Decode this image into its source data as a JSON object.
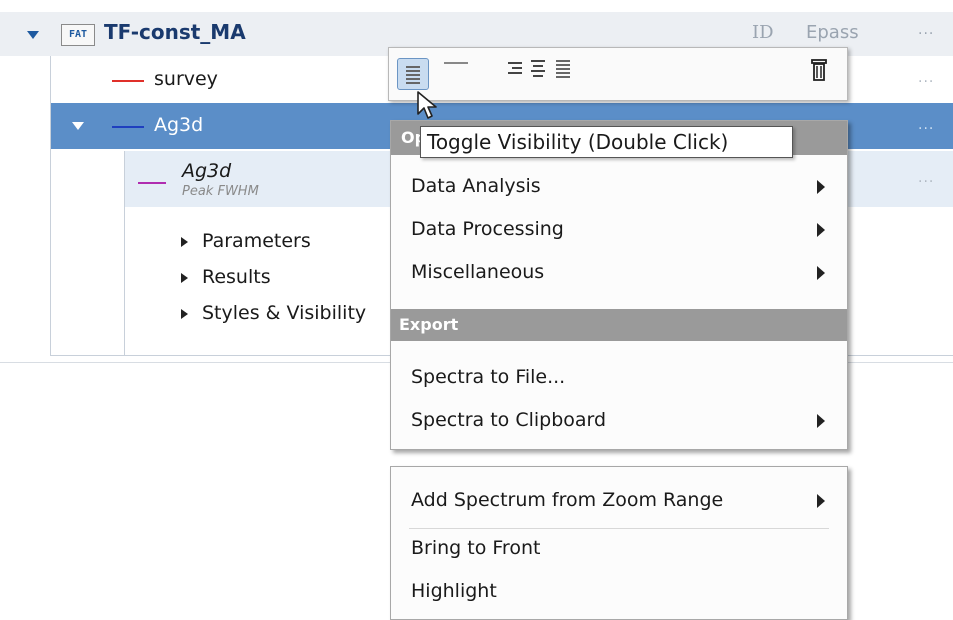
{
  "tree": {
    "root": {
      "badge": "FAT",
      "title": "TF-const_MA",
      "col_id": "ID",
      "col_epass": "Epass",
      "more": "..."
    },
    "rows": [
      {
        "label": "survey",
        "line_color": "#e0302a",
        "more": "..."
      },
      {
        "label": "Ag3d",
        "line_color": "#1f3fbf",
        "more": "..."
      },
      {
        "label": "Ag3d",
        "sublabel": "Peak FWHM",
        "line_color": "#b02db0",
        "more": "..."
      }
    ],
    "children": [
      "Parameters",
      "Results",
      "Styles & Visibility"
    ]
  },
  "toolbar": {
    "icons": [
      "lines-icon",
      "dash-icon",
      "align-right-icon",
      "align-center-icon",
      "align-justify-icon",
      "trash-icon"
    ]
  },
  "tooltip": {
    "text": "Toggle Visibility (Double Click)"
  },
  "menu1": {
    "header_fragment": "Op",
    "items": [
      "Data Analysis",
      "Data Processing",
      "Miscellaneous"
    ],
    "export_header": "Export",
    "export_items": [
      "Spectra to File...",
      "Spectra to Clipboard"
    ]
  },
  "menu2": {
    "items": [
      "Add Spectrum from Zoom Range",
      "Bring to Front",
      "Highlight"
    ]
  },
  "colors": {
    "selection": "#5b8ec8",
    "sub_selection": "#e5edf6",
    "header_bg": "#eceff3",
    "accent": "#1e5aa0"
  }
}
